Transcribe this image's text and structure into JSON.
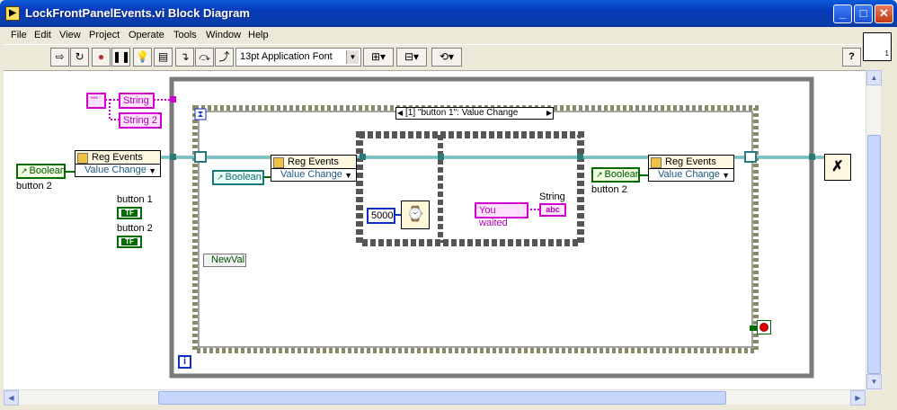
{
  "window": {
    "title": "LockFrontPanelEvents.vi Block Diagram",
    "icon_glyph": "▶",
    "minimize_glyph": "_",
    "maximize_glyph": "□",
    "close_glyph": "✕"
  },
  "menu": [
    "File",
    "Edit",
    "View",
    "Project",
    "Operate",
    "Tools",
    "Window",
    "Help"
  ],
  "toolbar": {
    "font_select": "13pt Application Font",
    "run_icon": "run-arrow-icon",
    "help_glyph": "?",
    "vi_icon_text": "1"
  },
  "diagram": {
    "left": {
      "bool_label": "Boolean",
      "bool_caption": "button 2",
      "reg_events_title": "Reg Events",
      "reg_events_option": "Value Change",
      "string_const_1": "String",
      "string_const_2": "String 2",
      "empty_string": "\"\"",
      "button1_label": "button 1",
      "button2_label": "button 2"
    },
    "event_structure": {
      "case_selector": "[1] \"button 1\": Value Change",
      "inner_bool_label": "Boolean",
      "inner_reg_title": "Reg Events",
      "inner_reg_option": "Value Change",
      "newval_label": "NewVal",
      "wait_ms_value": "5000",
      "you_waited_text": "You waited",
      "string_indicator_label": "String",
      "string_indicator_icon": "abc",
      "right_bool_label": "Boolean",
      "right_bool_caption": "button 2",
      "right_reg_title": "Reg Events",
      "right_reg_option": "Value Change"
    },
    "loop_iteration": "i"
  }
}
